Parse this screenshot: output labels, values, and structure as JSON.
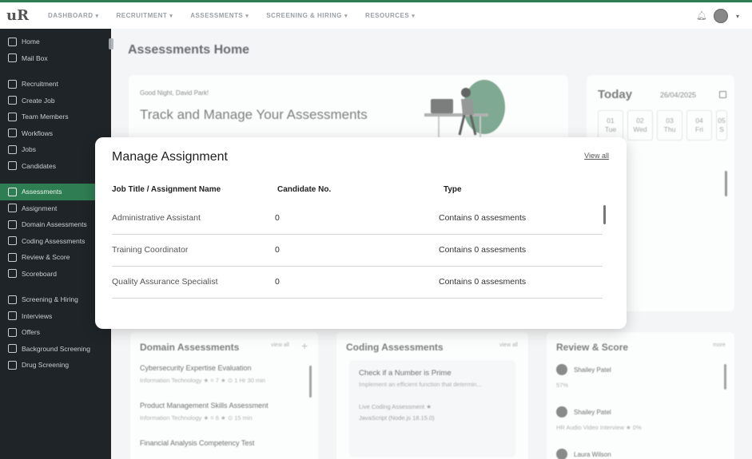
{
  "logo": "uR",
  "nav": [
    {
      "label": "DASHBOARD"
    },
    {
      "label": "RECRUITMENT"
    },
    {
      "label": "ASSESSMENTS"
    },
    {
      "label": "SCREENING & HIRING"
    },
    {
      "label": "RESOURCES"
    }
  ],
  "sidebar": {
    "group1": [
      {
        "label": "Home"
      },
      {
        "label": "Mail Box"
      }
    ],
    "group2": [
      {
        "label": "Recruitment"
      },
      {
        "label": "Create Job"
      },
      {
        "label": "Team Members"
      },
      {
        "label": "Workflows"
      },
      {
        "label": "Jobs"
      },
      {
        "label": "Candidates"
      }
    ],
    "group3": [
      {
        "label": "Assessments"
      },
      {
        "label": "Assignment"
      },
      {
        "label": "Domain Assessments"
      },
      {
        "label": "Coding Assessments"
      },
      {
        "label": "Review & Score"
      },
      {
        "label": "Scoreboard"
      }
    ],
    "group4": [
      {
        "label": "Screening & Hiring"
      },
      {
        "label": "Interviews"
      },
      {
        "label": "Offers"
      },
      {
        "label": "Background Screening"
      },
      {
        "label": "Drug Screening"
      }
    ]
  },
  "main": {
    "page_title": "Assessments Home",
    "greeting": "Good Night, David Park!",
    "hero_title": "Track and Manage Your Assessments",
    "today": {
      "title": "Today",
      "date": "26/04/2025",
      "days": [
        {
          "num": "01",
          "name": "Tue"
        },
        {
          "num": "02",
          "name": "Wed"
        },
        {
          "num": "03",
          "name": "Thu"
        },
        {
          "num": "04",
          "name": "Fri"
        },
        {
          "num": "05",
          "name": "S"
        }
      ]
    },
    "domain": {
      "title": "Domain Assessments",
      "view_all": "view all",
      "items": [
        {
          "title": "Cybersecurity Expertise Evaluation",
          "meta": "Information Technology  ★ = 7  ★  ⊙ 1 Hr 30 min"
        },
        {
          "title": "Product Management Skills Assessment",
          "meta": "Information Technology  ★ = 6  ★  ⊙ 15 min"
        },
        {
          "title": "Financial Analysis Competency Test",
          "meta": ""
        }
      ]
    },
    "coding": {
      "title": "Coding Assessments",
      "view_all": "view all",
      "item_title": "Check if a Number is Prime",
      "item_desc": "Implement an efficient function that determin...",
      "item_meta1": "Live Coding Assessment  ★",
      "item_meta2": "JavaScript (Node.js 18.15.0)"
    },
    "review": {
      "title": "Review & Score",
      "view_all": "more",
      "items": [
        {
          "name": "Shailey Patel",
          "meta": "57%"
        },
        {
          "name": "Shailey Patel",
          "meta": "HR Audio Video Interview  ★  0%"
        },
        {
          "name": "Laura Wilson",
          "meta": ""
        }
      ]
    }
  },
  "modal": {
    "title": "Manage Assignment",
    "view_all": "View all",
    "columns": {
      "name": "Job Title / Assignment Name",
      "candidates": "Candidate No.",
      "type": "Type"
    },
    "rows": [
      {
        "name": "Administrative Assistant",
        "candidates": "0",
        "type": "Contains 0 assesments"
      },
      {
        "name": "Training Coordinator",
        "candidates": "0",
        "type": "Contains 0 assesments"
      },
      {
        "name": "Quality Assurance Specialist",
        "candidates": "0",
        "type": "Contains 0 assesments"
      }
    ]
  }
}
